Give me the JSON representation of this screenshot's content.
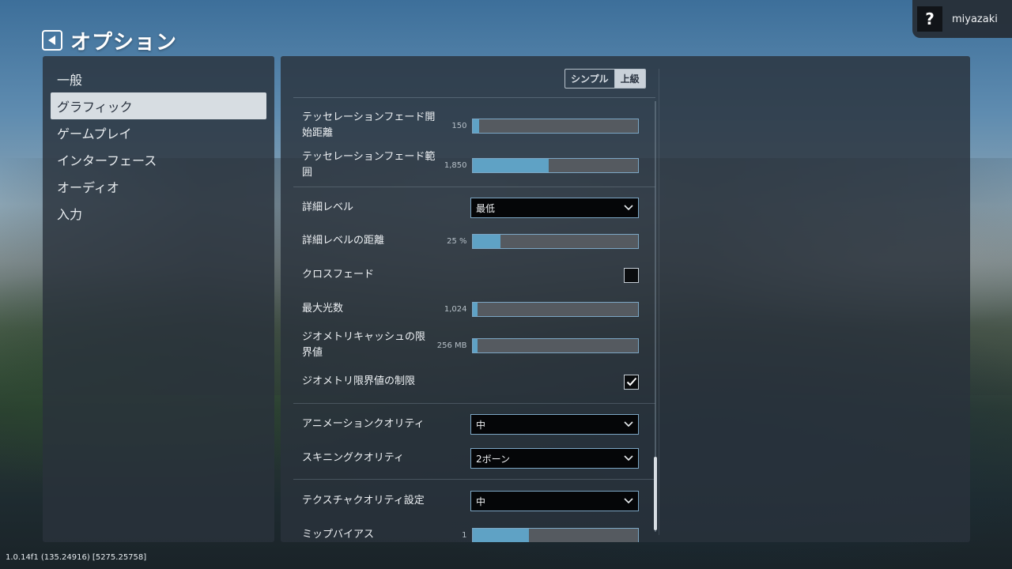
{
  "header": {
    "title": "オプション",
    "back_icon": "back-arrow-icon"
  },
  "user": {
    "help_label": "?",
    "name": "miyazaki"
  },
  "categories": [
    {
      "label": "一般",
      "active": false
    },
    {
      "label": "グラフィック",
      "active": true
    },
    {
      "label": "ゲームプレイ",
      "active": false
    },
    {
      "label": "インターフェース",
      "active": false
    },
    {
      "label": "オーディオ",
      "active": false
    },
    {
      "label": "入力",
      "active": false
    }
  ],
  "mode": {
    "simple_label": "シンプル",
    "advanced_label": "上級",
    "selected": "上級"
  },
  "settings": {
    "tess_fade_start": {
      "label": "テッセレーションフェード開始距離",
      "value": "150",
      "fill": 0.04
    },
    "tess_fade_range": {
      "label": "テッセレーションフェード範囲",
      "value": "1,850",
      "fill": 0.46
    },
    "detail_level": {
      "label": "詳細レベル",
      "value": "最低"
    },
    "detail_distance": {
      "label": "詳細レベルの距離",
      "value": "25 %",
      "fill": 0.17
    },
    "cross_fade": {
      "label": "クロスフェード",
      "checked": false
    },
    "max_lights": {
      "label": "最大光数",
      "value": "1,024",
      "fill": 0.03
    },
    "geometry_cache": {
      "label": "ジオメトリキャッシュの限界値",
      "value": "256 MB",
      "fill": 0.03
    },
    "geometry_limit": {
      "label": "ジオメトリ限界値の制限",
      "checked": true
    },
    "animation_quality": {
      "label": "アニメーションクオリティ",
      "value": "中"
    },
    "skinning_quality": {
      "label": "スキニングクオリティ",
      "value": "2ボーン"
    },
    "texture_quality": {
      "label": "テクスチャクオリティ設定",
      "value": "中"
    },
    "mip_bias": {
      "label": "ミップバイアス",
      "value": "1",
      "fill": 0.34
    }
  },
  "version": "1.0.14f1 (135.24916) [5275.25758]",
  "colors": {
    "accent": "#5fa2c5",
    "border": "#7ca6c4",
    "panel": "#2a323c"
  }
}
